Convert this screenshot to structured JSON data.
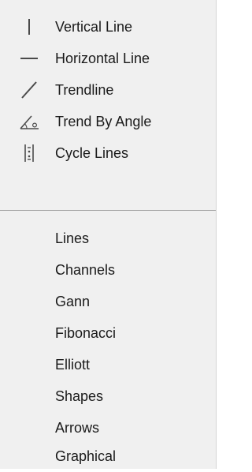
{
  "menu": {
    "tool_items": [
      {
        "label": "Vertical Line",
        "icon": "vertical-line-icon"
      },
      {
        "label": "Horizontal Line",
        "icon": "horizontal-line-icon"
      },
      {
        "label": "Trendline",
        "icon": "trendline-icon"
      },
      {
        "label": "Trend By Angle",
        "icon": "trend-by-angle-icon"
      },
      {
        "label": "Cycle Lines",
        "icon": "cycle-lines-icon"
      }
    ],
    "category_items": [
      {
        "label": "Lines"
      },
      {
        "label": "Channels"
      },
      {
        "label": "Gann"
      },
      {
        "label": "Fibonacci"
      },
      {
        "label": "Elliott"
      },
      {
        "label": "Shapes"
      },
      {
        "label": "Arrows"
      },
      {
        "label": "Graphical"
      }
    ]
  }
}
